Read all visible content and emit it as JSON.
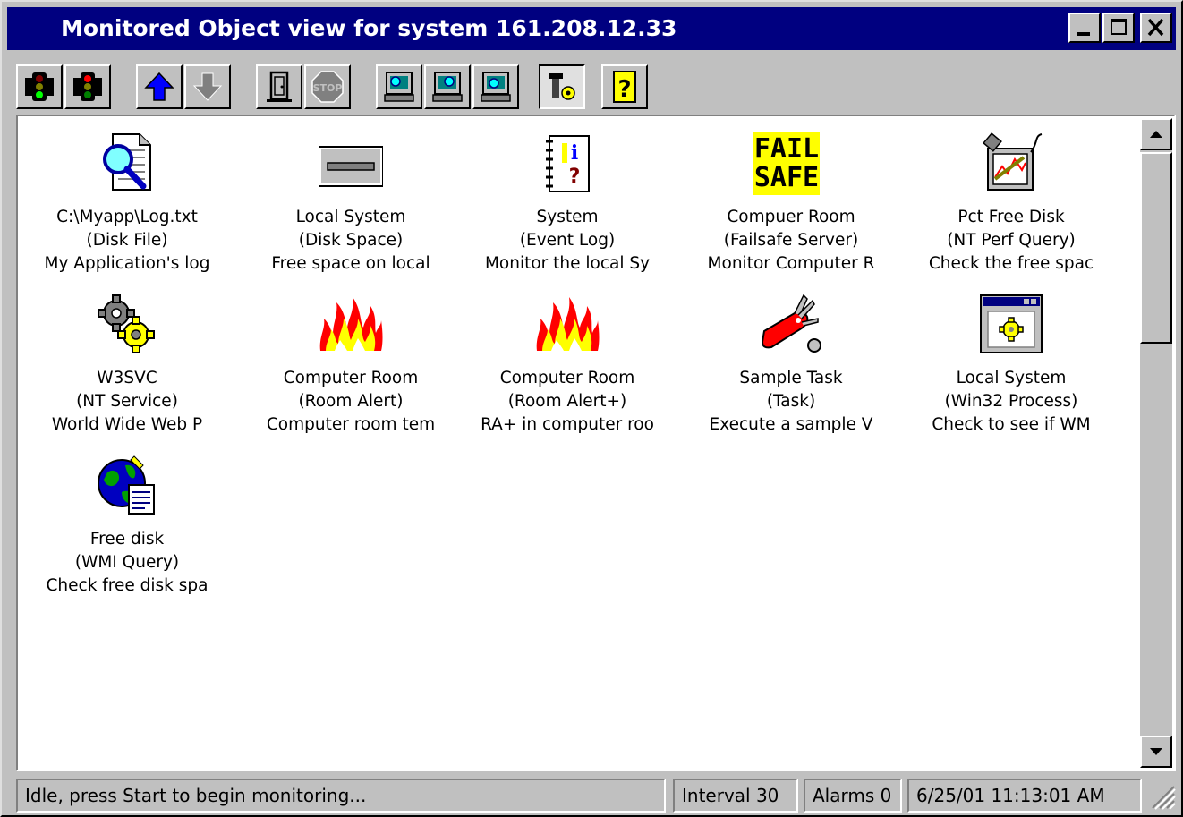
{
  "window": {
    "title": "Monitored Object view for system 161.208.12.33"
  },
  "toolbar": {
    "buttons": [
      {
        "name": "start-traffic-light-icon"
      },
      {
        "name": "stop-traffic-light-icon"
      },
      {
        "name": "move-up-icon"
      },
      {
        "name": "move-down-disabled-icon"
      },
      {
        "name": "door-icon"
      },
      {
        "name": "stop-disabled-icon"
      },
      {
        "name": "monitor-1-icon"
      },
      {
        "name": "monitor-2-icon"
      },
      {
        "name": "monitor-3-icon"
      },
      {
        "name": "tools-icon"
      },
      {
        "name": "help-icon"
      }
    ]
  },
  "items": [
    {
      "name": "C:\\Myapp\\Log.txt",
      "type": "(Disk File)",
      "desc": "My Application's log",
      "icon": "disk-file-icon"
    },
    {
      "name": "Local System",
      "type": "(Disk Space)",
      "desc": "Free space on local",
      "icon": "disk-space-icon"
    },
    {
      "name": "System",
      "type": "(Event Log)",
      "desc": "Monitor the local Sy",
      "icon": "event-log-icon"
    },
    {
      "name": "Compuer Room",
      "type": "(Failsafe Server)",
      "desc": "Monitor Computer R",
      "icon": "failsafe-icon",
      "icon_text": [
        "FAIL",
        "SAFE"
      ]
    },
    {
      "name": "Pct Free Disk",
      "type": "(NT Perf Query)",
      "desc": "Check the free spac",
      "icon": "perf-query-icon"
    },
    {
      "name": "W3SVC",
      "type": "(NT Service)",
      "desc": "World Wide Web P",
      "icon": "gears-icon"
    },
    {
      "name": "Computer Room",
      "type": "(Room Alert)",
      "desc": "Computer room tem",
      "icon": "fire-icon"
    },
    {
      "name": "Computer Room",
      "type": "(Room Alert+)",
      "desc": "RA+ in computer roo",
      "icon": "fire-icon"
    },
    {
      "name": "Sample Task",
      "type": "(Task)",
      "desc": "Execute a sample V",
      "icon": "knife-icon"
    },
    {
      "name": "Local System",
      "type": "(Win32 Process)",
      "desc": "Check to see if WM",
      "icon": "process-window-icon"
    },
    {
      "name": "Free disk",
      "type": "(WMI Query)",
      "desc": "Check free disk spa",
      "icon": "wmi-globe-icon"
    }
  ],
  "status": {
    "message": "Idle, press Start to begin monitoring...",
    "interval": "Interval 30",
    "alarms": "Alarms 0",
    "datetime": "6/25/01 11:13:01 AM"
  },
  "colors": {
    "titlebar": "#000080",
    "face": "#c0c0c0",
    "failsafe_bg": "#ffff00"
  }
}
